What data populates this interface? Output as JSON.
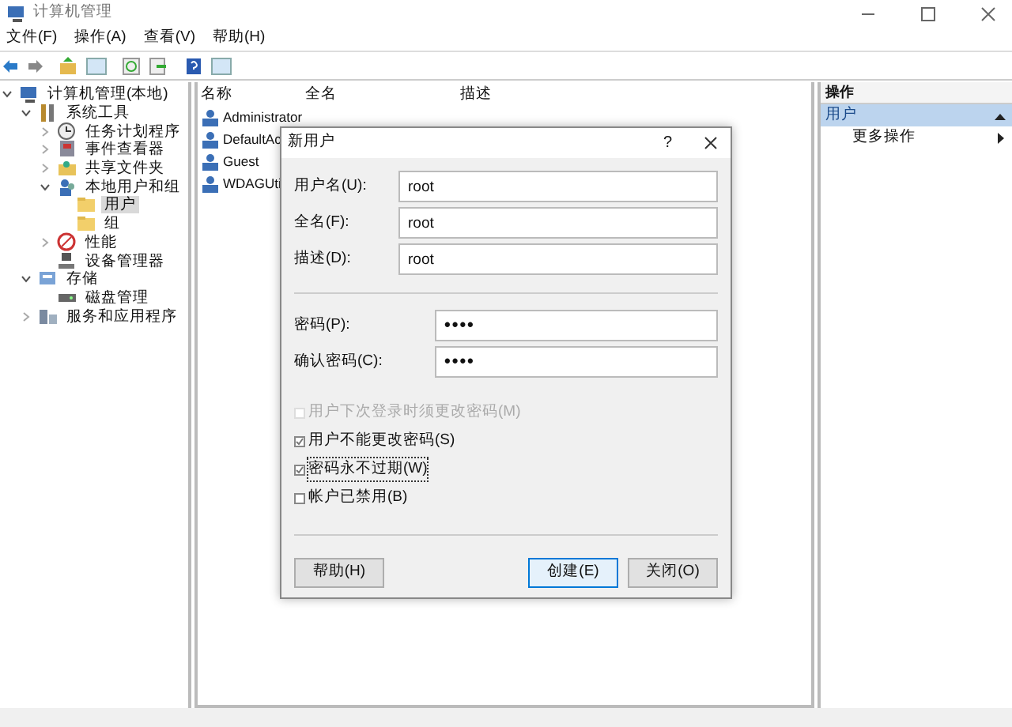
{
  "window": {
    "title": "计算机管理"
  },
  "menu": [
    "文件(F)",
    "操作(A)",
    "查看(V)",
    "帮助(H)"
  ],
  "tree": [
    {
      "label": "计算机管理(本地)",
      "expanded": true,
      "selected": false,
      "children": [
        {
          "label": "系统工具",
          "expanded": true,
          "selected": false,
          "children": [
            {
              "label": "任务计划程序",
              "expanded": false,
              "selected": false
            },
            {
              "label": "事件查看器",
              "expanded": false,
              "selected": false
            },
            {
              "label": "共享文件夹",
              "expanded": false,
              "selected": false
            },
            {
              "label": "本地用户和组",
              "expanded": true,
              "selected": false,
              "children": [
                {
                  "label": "用户",
                  "selected": true
                },
                {
                  "label": "组",
                  "selected": false
                }
              ]
            },
            {
              "label": "性能",
              "expanded": false,
              "selected": false
            },
            {
              "label": "设备管理器",
              "selected": false
            }
          ]
        },
        {
          "label": "存储",
          "expanded": true,
          "selected": false,
          "children": [
            {
              "label": "磁盘管理",
              "selected": false
            }
          ]
        },
        {
          "label": "服务和应用程序",
          "expanded": false,
          "selected": false
        }
      ]
    }
  ],
  "list": {
    "columns": [
      "名称",
      "全名",
      "描述"
    ],
    "rows": [
      {
        "name": "Administrator"
      },
      {
        "name": "DefaultAc"
      },
      {
        "name": "Guest"
      },
      {
        "name": "WDAGUti"
      }
    ]
  },
  "actions": {
    "title": "操作",
    "section": "用户",
    "items": [
      "更多操作"
    ]
  },
  "dialog": {
    "title": "新用户",
    "help": "?",
    "fields": [
      {
        "label": "用户名(U):",
        "value": "root",
        "kind": "text"
      },
      {
        "label": "全名(F):",
        "value": "root",
        "kind": "text"
      },
      {
        "label": "描述(D):",
        "value": "root",
        "kind": "text"
      },
      {
        "label": "密码(P):",
        "value": "••••",
        "kind": "password"
      },
      {
        "label": "确认密码(C):",
        "value": "••••",
        "kind": "password"
      }
    ],
    "checkboxes": [
      {
        "label": "用户下次登录时须更改密码(M)",
        "checked": false,
        "disabled": true,
        "focused": false
      },
      {
        "label": "用户不能更改密码(S)",
        "checked": true,
        "disabled": false,
        "focused": false
      },
      {
        "label": "密码永不过期(W)",
        "checked": true,
        "disabled": false,
        "focused": true
      },
      {
        "label": "帐户已禁用(B)",
        "checked": false,
        "disabled": false,
        "focused": false
      }
    ],
    "buttons": [
      {
        "label": "帮助(H)",
        "primary": false
      },
      {
        "label": "创建(E)",
        "primary": true
      },
      {
        "label": "关闭(O)",
        "primary": false
      }
    ]
  }
}
